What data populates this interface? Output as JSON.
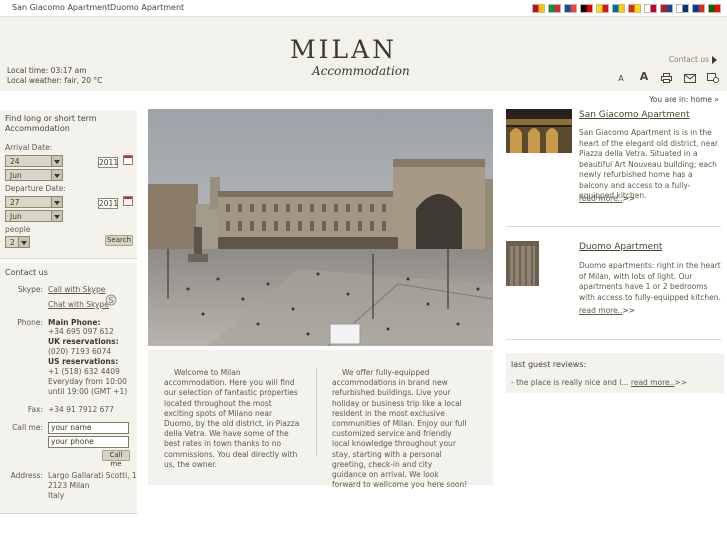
{
  "topnav": {
    "link1": "San Giacomo Apartment",
    "sep": "|",
    "link2": "Duomo Apartment"
  },
  "flags": [
    {
      "name": "flag-spain-icon",
      "c1": "#c60b1e",
      "c2": "#ffc400"
    },
    {
      "name": "flag-italy-icon",
      "c1": "#009246",
      "c2": "#ce2b37"
    },
    {
      "name": "flag-france-icon",
      "c1": "#0055a4",
      "c2": "#ef4135"
    },
    {
      "name": "flag-germany-icon",
      "c1": "#000000",
      "c2": "#dd0000"
    },
    {
      "name": "flag-catalonia-icon",
      "c1": "#fcdd09",
      "c2": "#da121a"
    },
    {
      "name": "flag-sweden-icon",
      "c1": "#006aa7",
      "c2": "#fecc00"
    },
    {
      "name": "flag-china-icon",
      "c1": "#de2910",
      "c2": "#ffde00"
    },
    {
      "name": "flag-japan-icon",
      "c1": "#ffffff",
      "c2": "#bc002d"
    },
    {
      "name": "flag-netherlands-icon",
      "c1": "#ae1c28",
      "c2": "#21468b"
    },
    {
      "name": "flag-korea-icon",
      "c1": "#ffffff",
      "c2": "#003478"
    },
    {
      "name": "flag-russia-icon",
      "c1": "#0039a6",
      "c2": "#d52b1e"
    },
    {
      "name": "flag-portugal-icon",
      "c1": "#006600",
      "c2": "#ff0000"
    }
  ],
  "header": {
    "logo": "MILAN",
    "logo_sub": "Accommodation",
    "local_time": "Local time: 03:17 am",
    "local_weather": "Local weather: fair, 20 °C",
    "contact_us": "Contact us",
    "font_small": "A",
    "font_large": "A"
  },
  "breadcrumb": "You are in: home »",
  "search": {
    "title": "Find long or short term Accommodation",
    "arrival_label": "Arrival Date:",
    "arrival_day": "24",
    "arrival_month": "Jun",
    "arrival_year": "2011",
    "departure_label": "Departure Date:",
    "departure_day": "27",
    "departure_month": "Jun",
    "departure_year": "2011",
    "people_label": "people",
    "people_value": "2",
    "search_button": "Search"
  },
  "contact": {
    "title": "Contact us",
    "skype_label": "Skype:",
    "call_skype": "Call with Skype",
    "chat_skype": "Chat with Skype",
    "phone_label": "Phone:",
    "main_phone_title": "Main Phone:",
    "main_phone": "+34 695 097 612",
    "uk_title": "UK reservations:",
    "uk_phone": "(020) 7193 6074",
    "us_title": "US reservations:",
    "us_phone": "+1 (518) 632 4409",
    "hours1": "Everyday from 10:00",
    "hours2": "until 19:00 (GMT +1)",
    "fax_label": "Fax:",
    "fax": "+34 91 7912 677",
    "callme_label": "Call me:",
    "name_placeholder": "your name",
    "phone_placeholder": "your phone",
    "callme_button": "Call me",
    "address_label": "Address:",
    "address1": "Largo Gallarati Scotti, 1",
    "address2": "2123 Milan",
    "address3": "Italy"
  },
  "welcome": {
    "col1": "Welcome to Milan accommodation. Here you will find our selection of fantastic properties located throughout the most exciting spots of Milano near Duomo, by the old district, in Piazza della Vetra. We have some of the best rates in town thanks to no commissions. You deal directly with us, the owner.",
    "col2": "We offer fully-equipped accommodations in brand new refurbished buildings. Live your holiday or business trip like a local resident in the most exclusive communities of Milan. Enjoy our full customized service and friendly local knowledge throughout your stay, starting with a personal greeting, check-in and city guidance on arrival. We look forward to wellcome you here soon!"
  },
  "apartments": [
    {
      "title": "San Giacomo Apartment",
      "text": "San Giacomo Apartment is is in the heart of the elegant old district, near Piazza della Vetra. Situated in a beautiful Art Nouveau building; each newly refurbished home has a balcony and access to a fully-equipped kitchen.",
      "read_more": "read more..",
      "arrow": ">>"
    },
    {
      "title": "Duomo Apartment",
      "text": "Duomo apartments: right in the heart of Milan, with lots of light. Our apartments have 1 or 2 bedrooms with access to fully-equipped kitchen.",
      "read_more": "read more..",
      "arrow": ">>"
    }
  ],
  "reviews": {
    "title": "last guest reviews:",
    "text": "- the place is really nice and l...",
    "read_more": "read more..",
    "arrow": ">>"
  }
}
